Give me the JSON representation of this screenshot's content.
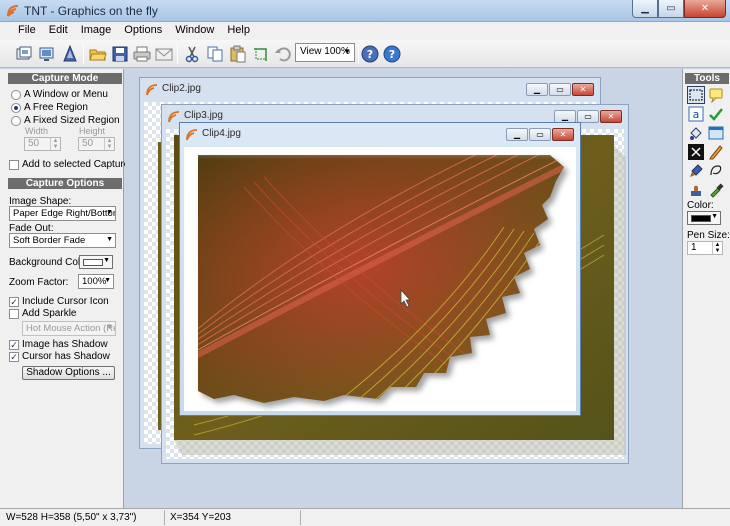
{
  "window": {
    "title": "TNT - Graphics on the fly",
    "min_icon": "minimize-icon",
    "max_icon": "maximize-icon",
    "close_icon": "close-icon"
  },
  "menu": [
    "File",
    "Edit",
    "Image",
    "Options",
    "Window",
    "Help"
  ],
  "toolbar": {
    "icons": [
      "capture-icon",
      "screen-icon",
      "wizard-icon",
      "open-folder-icon",
      "save-icon",
      "print-icon",
      "email-icon",
      "cut-icon",
      "copy-icon",
      "paste-icon",
      "crop-icon",
      "undo-icon",
      "help-icon",
      "about-icon"
    ],
    "zoom_value": "View 100%"
  },
  "capture_mode": {
    "heading": "Capture Mode",
    "options": [
      "A Window or Menu",
      "A Free Region",
      "A Fixed Sized Region"
    ],
    "selected_index": 1,
    "width_label": "Width",
    "height_label": "Height",
    "width_value": "50",
    "height_value": "50",
    "add_to_selected": "Add to selected Capture"
  },
  "capture_options": {
    "heading": "Capture Options",
    "image_shape_label": "Image Shape:",
    "image_shape_value": "Paper Edge Right/Bottom",
    "fade_out_label": "Fade Out:",
    "fade_out_value": "Soft Border Fade",
    "bg_color_label": "Background Color:",
    "bg_color_value": "#ffffff",
    "zoom_label": "Zoom Factor:",
    "zoom_value": "100%",
    "include_cursor": "Include Cursor Icon",
    "include_cursor_checked": true,
    "add_sparkle": "Add Sparkle",
    "add_sparkle_checked": false,
    "sparkle_action": "Hot Mouse Action (Re",
    "image_shadow": "Image has Shadow",
    "image_shadow_checked": true,
    "cursor_shadow": "Cursor has Shadow",
    "cursor_shadow_checked": true,
    "shadow_options_button": "Shadow Options ..."
  },
  "documents": [
    {
      "name": "Clip2.jpg"
    },
    {
      "name": "Clip3.jpg"
    },
    {
      "name": "Clip4.jpg"
    }
  ],
  "tools": {
    "heading": "Tools",
    "icons": [
      "select-rect-icon",
      "note-icon",
      "text-icon",
      "check-icon",
      "fill-icon",
      "window-icon",
      "x-icon",
      "pencil-icon",
      "brush-icon",
      "lasso-icon",
      "stamp-icon",
      "eyedropper-icon"
    ],
    "color_label": "Color:",
    "color_value": "#000000",
    "pen_size_label": "Pen Size:",
    "pen_size_value": "1"
  },
  "status": {
    "dimensions": "W=528  H=358  (5,50\" x 3,73\")",
    "position": "X=354  Y=203"
  }
}
